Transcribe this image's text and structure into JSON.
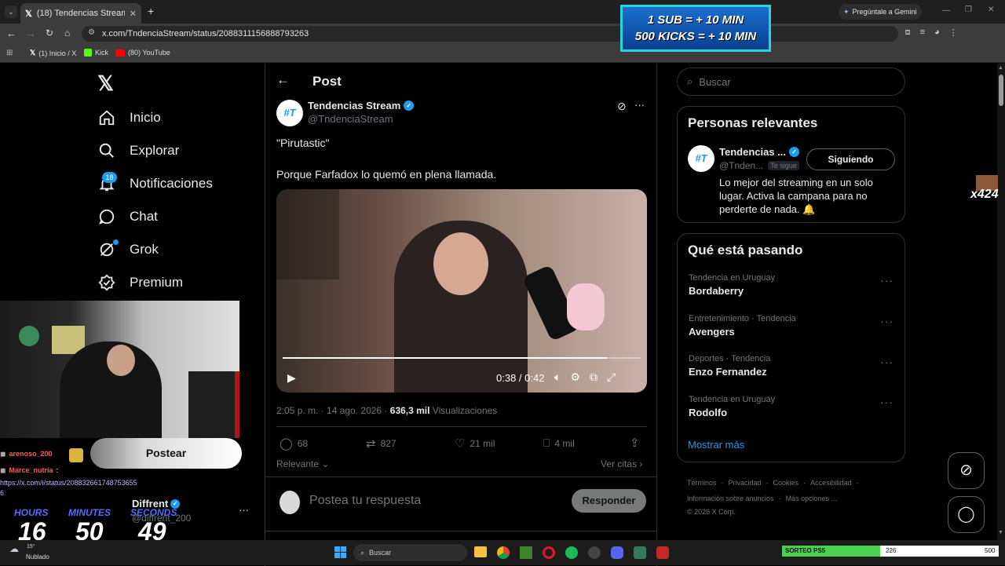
{
  "browser": {
    "tab_title": "(18) Tendencias Stream en X: \"",
    "url": "x.com/TndenciaStream/status/2088311156888793263",
    "gemini_label": "Pregúntale a Gemini",
    "bookmarks": [
      "(1) Inicio / X",
      "Kick",
      "(80) YouTube"
    ]
  },
  "overlay": {
    "sub_line1": "1 SUB = + 10 MIN",
    "sub_line2": "500 KICKS = + 10 MIN",
    "timer_labels": [
      "HOURS",
      "MINUTES",
      "SECONDS"
    ],
    "timer_values": [
      "16",
      "50",
      "49"
    ],
    "chat_user1": "arenoso_200",
    "chat_user2": "Marce_nutria",
    "chat_link": "https://x.com/i/status/208832661748753655",
    "chat_link_tail": "6",
    "badge_count": "424",
    "goal_label": "SORTEO PS5",
    "goal_current": "226",
    "goal_target": "500",
    "goal_progress": 0.452
  },
  "nav": {
    "items": [
      "Inicio",
      "Explorar",
      "Notificaciones",
      "Chat",
      "Grok",
      "Premium"
    ],
    "notif_badge": "18",
    "post_button": "Postear",
    "account_name": "Diffrent",
    "account_handle": "@diffrent_200"
  },
  "post": {
    "header": "Post",
    "author_name": "Tendencias Stream",
    "author_handle": "@TndenciaStream",
    "text_line1": "\"Pirutastic\"",
    "text_line2": "Porque Farfadox lo quemó en plena llamada.",
    "video_time": "0:38 / 0:42",
    "video_progress": 0.905,
    "timestamp": "2:05 p. m. · 14 ago. 2026 · ",
    "views_count": "636,3 mil",
    "views_label": " Visualizaciones",
    "replies": "68",
    "reposts": "827",
    "likes": "21 mil",
    "bookmarks": "4 mil",
    "sort_label": "Relevante",
    "quotes_label": "Ver citas",
    "reply_placeholder": "Postea tu respuesta",
    "reply_button": "Responder"
  },
  "sidebar": {
    "search_placeholder": "Buscar",
    "relevant_title": "Personas relevantes",
    "person_name": "Tendencias ...",
    "person_handle": "@Tnden...",
    "follows_you": "Te sigue",
    "following_button": "Siguiendo",
    "person_bio": "Lo mejor del streaming en un solo lugar. Activa la campana para no perderte de nada. 🔔",
    "trends_title": "Qué está pasando",
    "trends": [
      {
        "category": "Tendencia en Uruguay",
        "name": "Bordaberry"
      },
      {
        "category": "Entretenimiento · Tendencia",
        "name": "Avengers"
      },
      {
        "category": "Deportes · Tendencia",
        "name": "Enzo Fernandez"
      },
      {
        "category": "Tendencia en Uruguay",
        "name": "Rodolfo"
      }
    ],
    "show_more": "Mostrar más",
    "footer_line1": [
      "Términos",
      "Privacidad",
      "Cookies",
      "Accesibilidad"
    ],
    "footer_line2": [
      "Información sobre anuncios",
      "Más opciones ..."
    ],
    "copyright": "© 2026 X Corp."
  },
  "taskbar": {
    "search_label": "Buscar",
    "weather_temp": "15°",
    "weather_text": "Nublado"
  },
  "colors": {
    "accent": "#1d9bf0",
    "x_bg": "#000000",
    "border": "#2f3336"
  }
}
